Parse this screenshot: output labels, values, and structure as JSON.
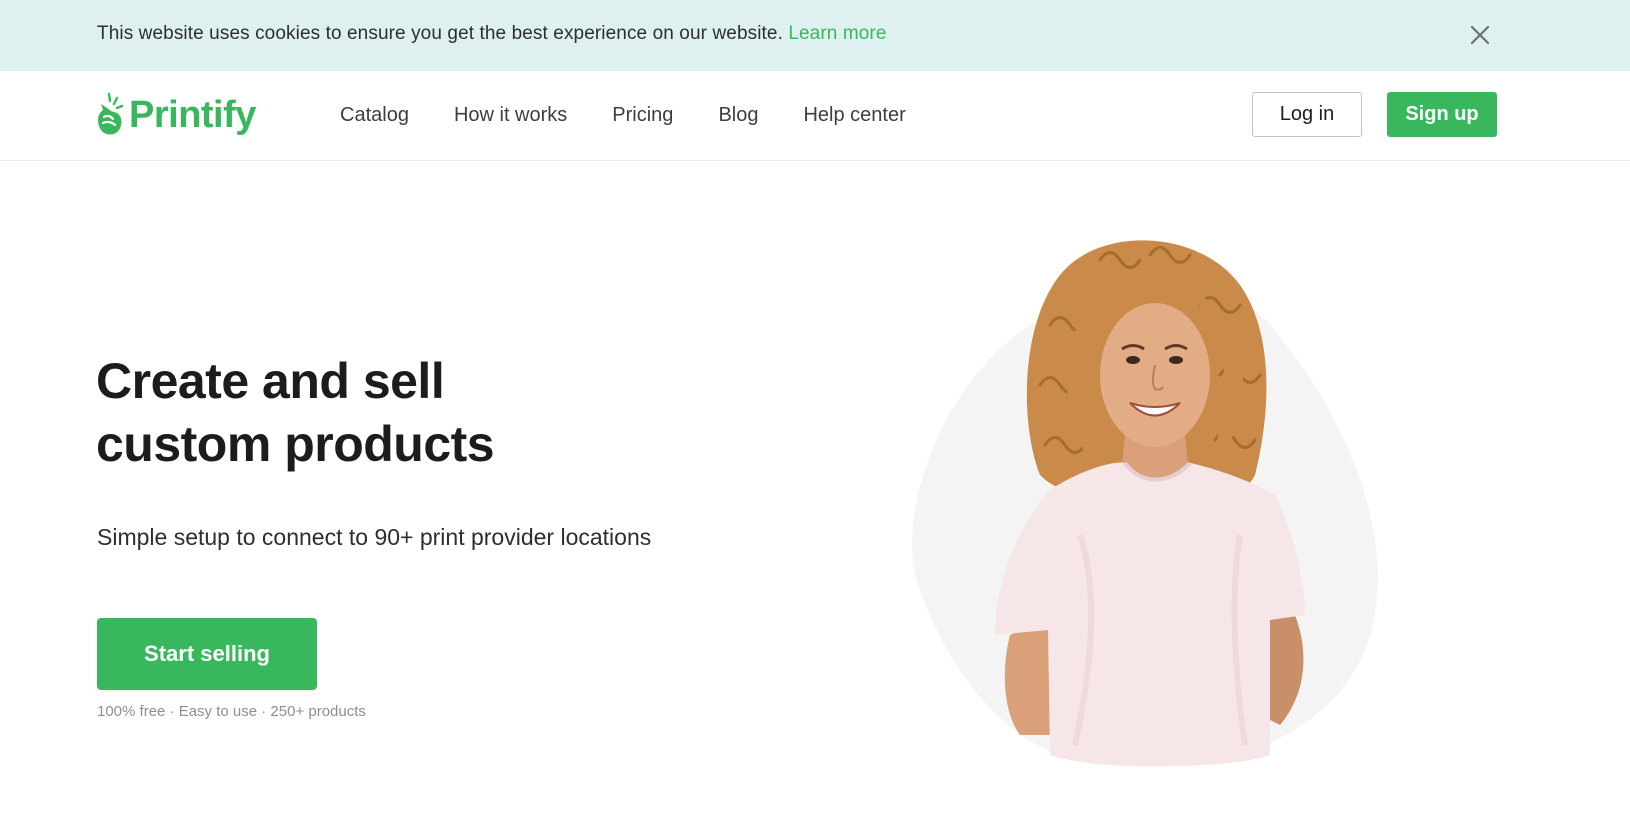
{
  "cookie_banner": {
    "message": "This website uses cookies to ensure you get the best experience on our website.",
    "link_label": "Learn more",
    "close_icon": "close-icon"
  },
  "header": {
    "logo_text": "Printify",
    "logo_icon": "printify-hand-icon",
    "nav": [
      {
        "label": "Catalog"
      },
      {
        "label": "How it works"
      },
      {
        "label": "Pricing"
      },
      {
        "label": "Blog"
      },
      {
        "label": "Help center"
      }
    ],
    "login_label": "Log in",
    "signup_label": "Sign up"
  },
  "hero": {
    "title_line1": "Create and sell",
    "title_line2": "custom products",
    "subtitle": "Simple setup to connect to 90+ print provider locations",
    "cta_label": "Start selling",
    "note": "100% free · Easy to use  · 250+ products",
    "image_desc_icon": "woman-in-tshirt-photo"
  },
  "colors": {
    "brand_green": "#39b75d",
    "cookie_bg": "#dff0f0",
    "text_dark": "#1c1c1c",
    "muted": "#8a8f94"
  }
}
